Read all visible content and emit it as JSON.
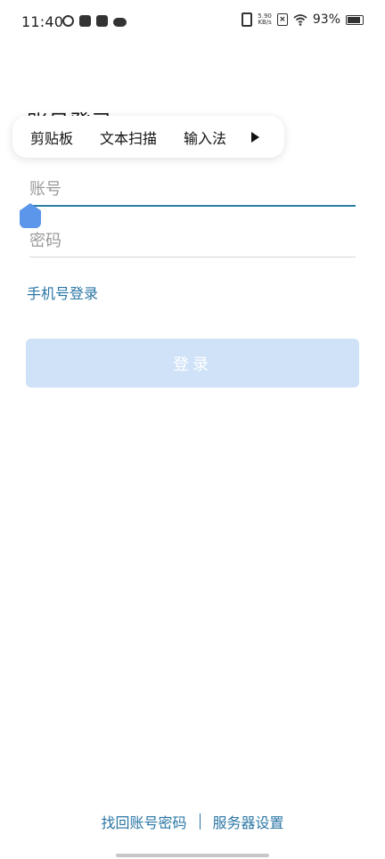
{
  "status_bar": {
    "time": "11:40",
    "net_speed_value": "5.90",
    "net_speed_unit": "KB/s",
    "battery_percent": "93%",
    "icons": [
      "sync-icon",
      "tiktok-icon",
      "notification-icon",
      "cloud-icon",
      "vibrate-icon",
      "sim-off-icon",
      "wifi-icon",
      "battery-icon"
    ]
  },
  "title": {
    "text": "账号登录"
  },
  "context_menu": {
    "items": [
      "剪贴板",
      "文本扫描",
      "输入法"
    ],
    "more_icon": "play-arrow-icon"
  },
  "form": {
    "account_placeholder": "账号",
    "password_placeholder": "密码",
    "phone_login_text": "手机号登录",
    "login_button_text": "登录"
  },
  "footer": {
    "find_password": "找回账号密码",
    "server_settings": "服务器设置"
  },
  "colors": {
    "accent": "#2a76a4",
    "button_disabled": "#cfe2f8",
    "cursor_handle": "#5b96ea"
  }
}
